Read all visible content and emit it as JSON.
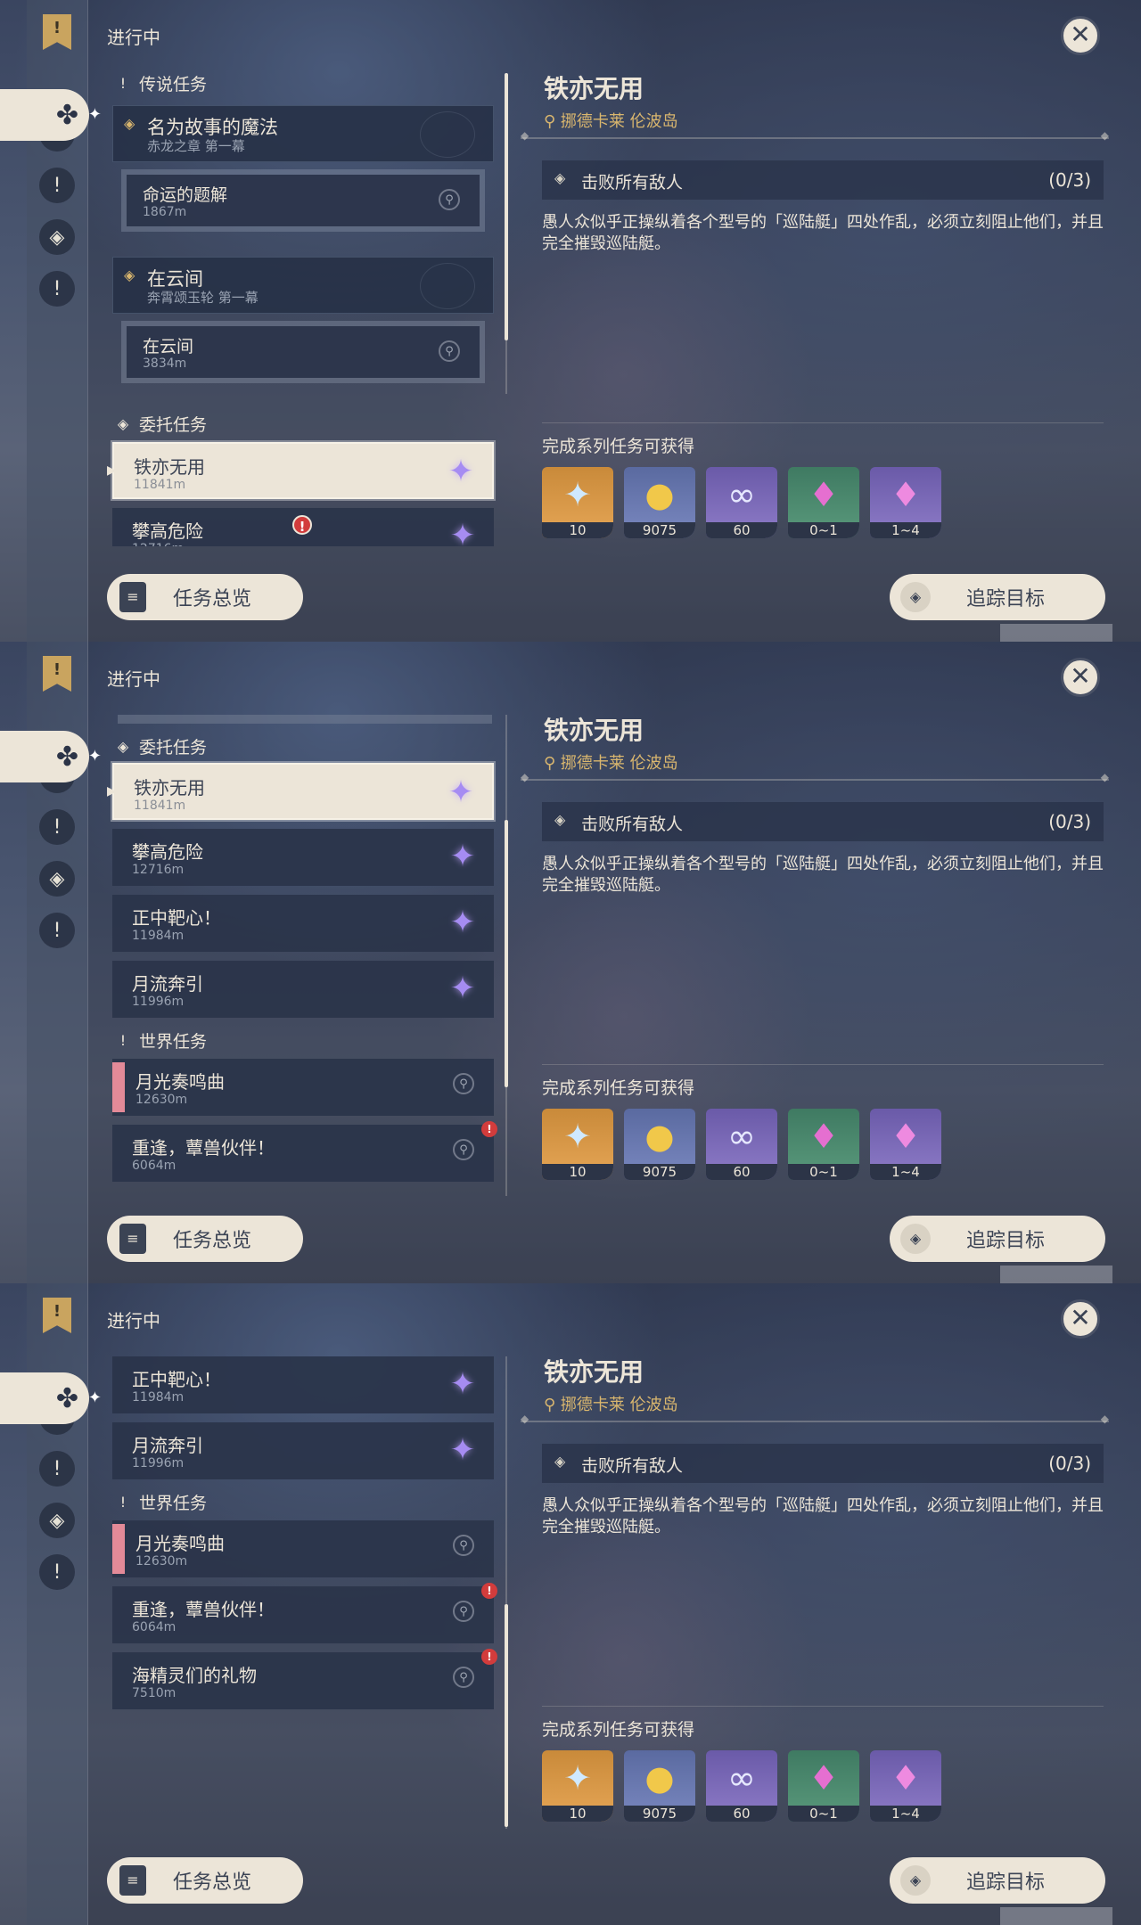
{
  "common": {
    "in_progress": "进行中",
    "overview_button": "任务总览",
    "track_button": "追踪目标"
  },
  "icons": {
    "bookmark": "bookmark-icon",
    "archon": "archon-quest-icon",
    "story": "story-quest-icon",
    "world": "world-quest-icon",
    "commission": "commission-icon",
    "close": "close-icon",
    "pin": "map-pin-icon"
  },
  "colors": {
    "cream": "#ece5d8",
    "gold": "#d9b66e",
    "panel_dark": "#2a344a",
    "alert": "#d23c3c",
    "commission_purple": "#a68cf2"
  },
  "detail": {
    "title": "铁亦无用",
    "location": "挪德卡莱 伦波岛",
    "objective": "击败所有敌人",
    "objective_count": "(0/3)",
    "description": "愚人众似乎正操纵着各个型号的「巡陆艇」四处作乱，必须立刻阻止他们，并且完全摧毁巡陆艇。",
    "rewards_title": "完成系列任务可获得",
    "rewards": [
      {
        "name": "primogem",
        "count": "10"
      },
      {
        "name": "mora",
        "count": "9075"
      },
      {
        "name": "companionship-exp",
        "count": "60"
      },
      {
        "name": "crystal-small",
        "count": "0~1"
      },
      {
        "name": "crystal-large",
        "count": "1~4"
      }
    ]
  },
  "sections": {
    "legend": "传说任务",
    "commission": "委托任务",
    "world": "世界任务"
  },
  "quests": {
    "q1_title": "名为故事的魔法",
    "q1_sub": "赤龙之章 第一幕",
    "q1_step": "命运的题解",
    "q1_dist": "1867m",
    "q2_title": "在云间",
    "q2_sub": "奔霄颂玉轮 第一幕",
    "q2_step": "在云间",
    "q2_dist": "3834m",
    "c1_title": "铁亦无用",
    "c1_dist": "11841m",
    "c2_title": "攀高危险",
    "c2_dist": "12716m",
    "c3_title": "正中靶心！",
    "c3_dist": "11984m",
    "c4_title": "月流奔引",
    "c4_dist": "11996m",
    "w1_title": "月光奏鸣曲",
    "w1_dist": "12630m",
    "w2_title": "重逢，蕈兽伙伴！",
    "w2_dist": "6064m",
    "w3_title": "海精灵们的礼物",
    "w3_dist": "7510m"
  },
  "alert_mark": "!"
}
